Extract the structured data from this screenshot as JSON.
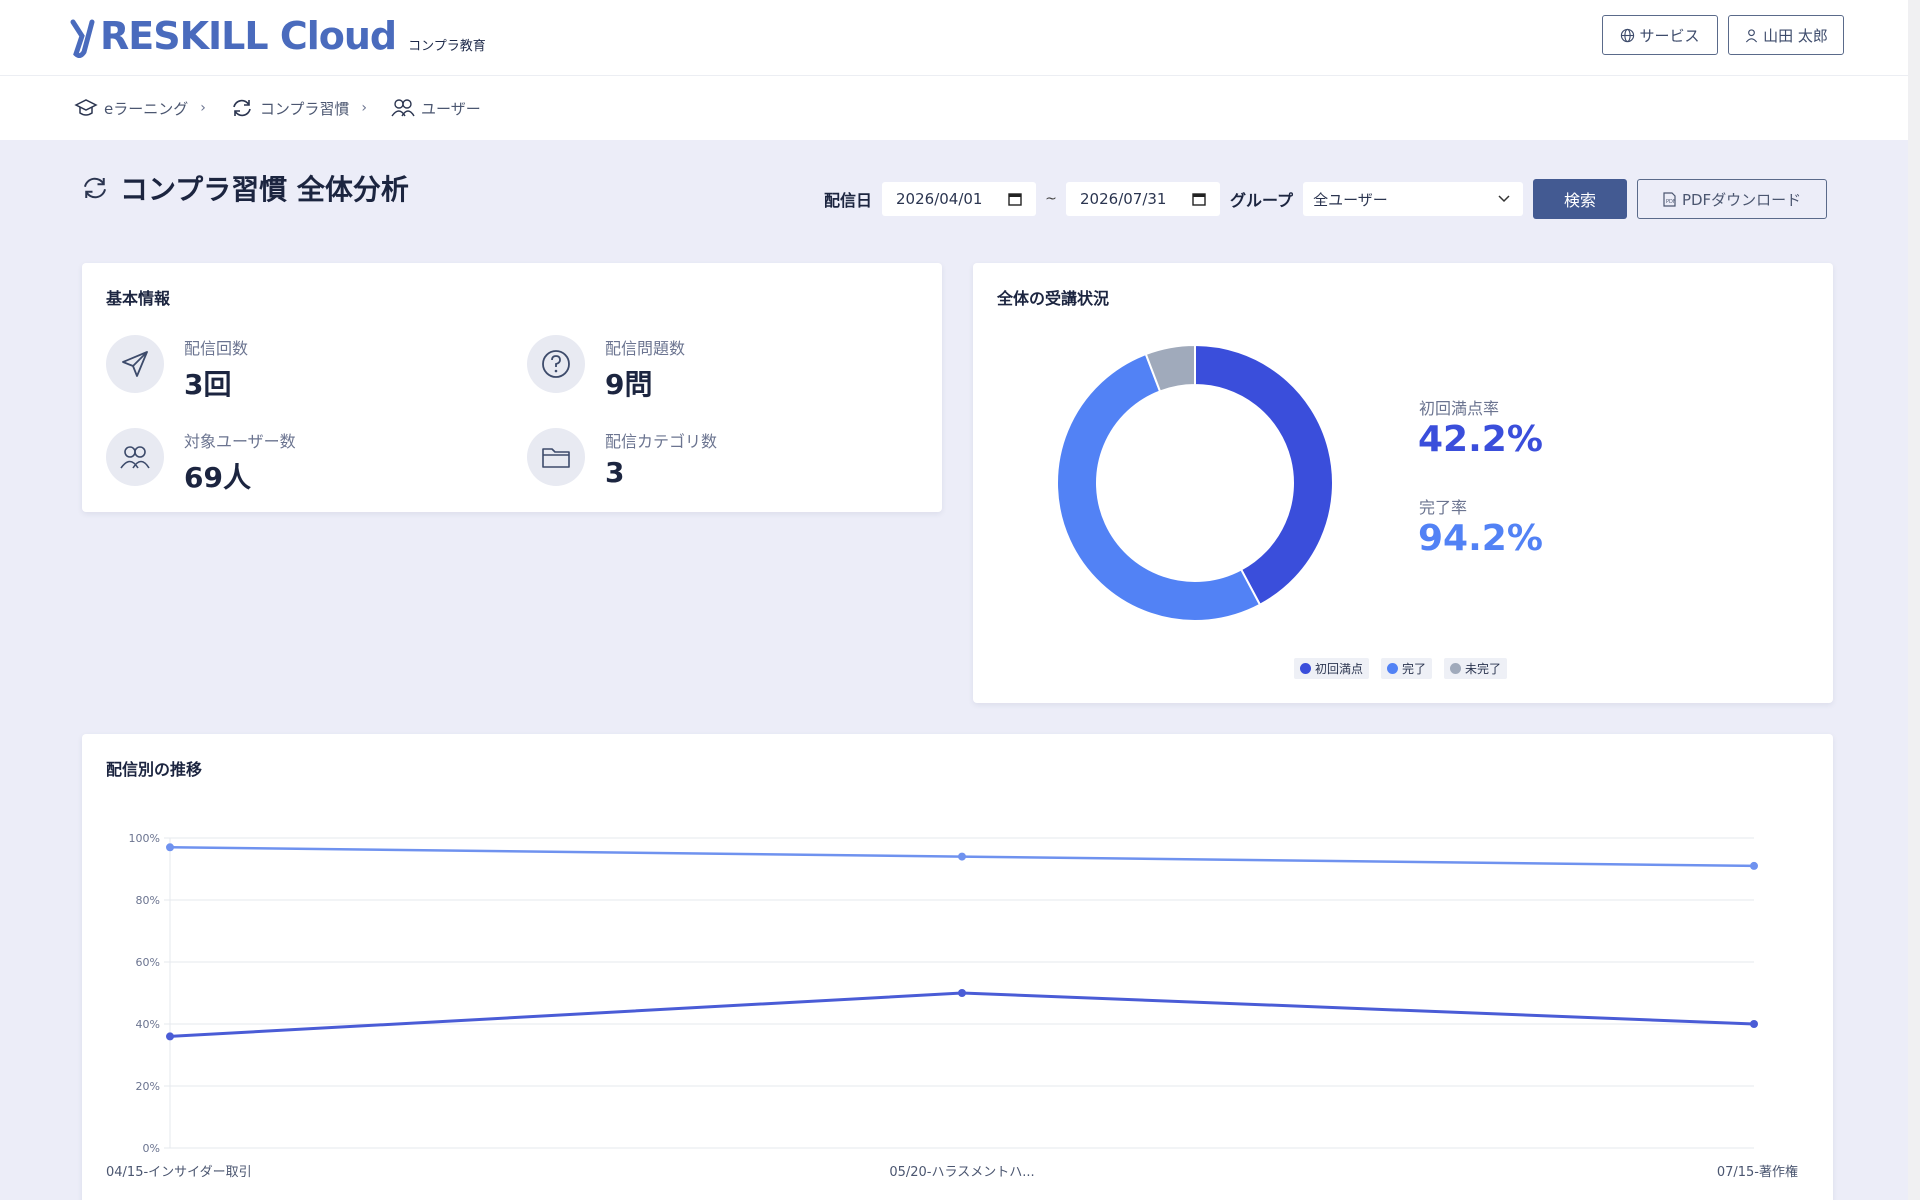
{
  "app": {
    "logo_text": "RESKILL Cloud",
    "logo_sub": "コンプラ教育",
    "service_button": "サービス",
    "user_button": "山田 太郎"
  },
  "breadcrumb": [
    {
      "label": "eラーニング",
      "icon": "graduation-cap-icon"
    },
    {
      "label": "コンプラ習慣",
      "icon": "sync-icon"
    },
    {
      "label": "ユーザー",
      "icon": "users-icon"
    }
  ],
  "page": {
    "title": "コンプラ習慣 全体分析"
  },
  "filters": {
    "date_label": "配信日",
    "date_from": "2026/04/01",
    "tilde": "~",
    "date_to": "2026/07/31",
    "group_label": "グループ",
    "group_value": "全ユーザー",
    "search_button": "検索",
    "pdf_button": "PDFダウンロード"
  },
  "basic_info": {
    "title": "基本情報",
    "stats": [
      {
        "label": "配信回数",
        "value": "3回",
        "icon": "send-icon"
      },
      {
        "label": "配信問題数",
        "value": "9問",
        "icon": "question-icon"
      },
      {
        "label": "対象ユーザー数",
        "value": "69人",
        "icon": "users-icon"
      },
      {
        "label": "配信カテゴリ数",
        "value": "3",
        "icon": "folder-icon"
      }
    ]
  },
  "status_card": {
    "title": "全体の受講状況",
    "first_perfect_label": "初回満点率",
    "first_perfect_value": "42.2%",
    "complete_label": "完了率",
    "complete_value": "94.2%",
    "legend": [
      "初回満点",
      "完了",
      "未完了"
    ]
  },
  "trend_card": {
    "title": "配信別の推移"
  },
  "colors": {
    "first_perfect": "#3a4edb",
    "complete": "#5282f5",
    "incomplete": "#a0aabb",
    "brand": "#4a6bbd",
    "primary_button": "#435a92"
  },
  "chart_data": [
    {
      "type": "pie",
      "labels": [
        "初回満点",
        "完了",
        "未完了"
      ],
      "values": [
        42.2,
        52.0,
        5.8
      ]
    },
    {
      "type": "line",
      "categories": [
        "04/15-インサイダー取引",
        "05/20-ハラスメントハ...",
        "07/15-著作権"
      ],
      "series": [
        {
          "values": [
            97,
            94,
            91
          ]
        },
        {
          "values": [
            36,
            50,
            40
          ]
        }
      ],
      "ylim": [
        0,
        100
      ],
      "yticks": [
        "0%",
        "20%",
        "40%",
        "60%",
        "80%",
        "100%"
      ],
      "grid": true
    }
  ]
}
